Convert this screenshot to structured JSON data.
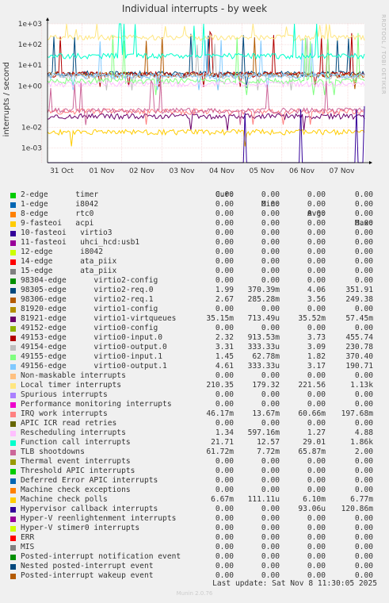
{
  "title": "Individual interrupts - by week",
  "side_label": "RRDTOOL / TOBI OETIKER",
  "footer": "Munin 2.0.76",
  "last_update": "Last update: Sat Nov  8 11:30:05 2025",
  "legend_headers": [
    "Cur:",
    "Min:",
    "Avg:",
    "Max:"
  ],
  "chart_data": {
    "type": "line",
    "ylabel": "interrupts / second",
    "yscale": "log",
    "ylim": [
      0.0002,
      1000
    ],
    "y_ticks": [
      {
        "v": 1000,
        "label": "1e+03"
      },
      {
        "v": 100,
        "label": "1e+02"
      },
      {
        "v": 10,
        "label": "1e+01"
      },
      {
        "v": 1,
        "label": "1e+00"
      },
      {
        "v": 0.01,
        "label": "1e-02"
      },
      {
        "v": 0.001,
        "label": "1e-03"
      }
    ],
    "x_ticks": [
      "31 Oct",
      "01 Nov",
      "02 Nov",
      "03 Nov",
      "04 Nov",
      "05 Nov",
      "06 Nov",
      "07 Nov"
    ],
    "series": [
      {
        "name": "2-edge      timer",
        "color": "#00cc00",
        "cur": "0.00",
        "min": "0.00",
        "avg": "0.00",
        "max": "0.00"
      },
      {
        "name": "1-edge      i8042",
        "color": "#0066b3",
        "cur": "0.00",
        "min": "0.00",
        "avg": "0.00",
        "max": "0.00"
      },
      {
        "name": "8-edge      rtc0",
        "color": "#ff8000",
        "cur": "0.00",
        "min": "0.00",
        "avg": "0.00",
        "max": "0.00"
      },
      {
        "name": "9-fasteoi   acpi",
        "color": "#ffcc00",
        "cur": "0.00",
        "min": "0.00",
        "avg": "0.00",
        "max": "0.00"
      },
      {
        "name": "10-fasteoi   virtio3",
        "color": "#330099",
        "cur": "0.00",
        "min": "0.00",
        "avg": "0.00",
        "max": "0.00"
      },
      {
        "name": "11-fasteoi   uhci_hcd:usb1",
        "color": "#990099",
        "cur": "0.00",
        "min": "0.00",
        "avg": "0.00",
        "max": "0.00"
      },
      {
        "name": "12-edge      i8042",
        "color": "#ccff00",
        "cur": "0.00",
        "min": "0.00",
        "avg": "0.00",
        "max": "0.00"
      },
      {
        "name": "14-edge      ata_piix",
        "color": "#ff0000",
        "cur": "0.00",
        "min": "0.00",
        "avg": "0.00",
        "max": "0.00"
      },
      {
        "name": "15-edge      ata_piix",
        "color": "#808080",
        "cur": "0.00",
        "min": "0.00",
        "avg": "0.00",
        "max": "0.00"
      },
      {
        "name": "98304-edge      virtio2-config",
        "color": "#008f00",
        "cur": "0.00",
        "min": "0.00",
        "avg": "0.00",
        "max": "0.00"
      },
      {
        "name": "98305-edge      virtio2-req.0",
        "color": "#00487d",
        "cur": "1.99",
        "min": "370.39m",
        "avg": "4.06",
        "max": "351.91"
      },
      {
        "name": "98306-edge      virtio2-req.1",
        "color": "#b35a00",
        "cur": "2.67",
        "min": "285.28m",
        "avg": "3.56",
        "max": "249.38"
      },
      {
        "name": "81920-edge      virtio1-config",
        "color": "#b38f00",
        "cur": "0.00",
        "min": "0.00",
        "avg": "0.00",
        "max": "0.00"
      },
      {
        "name": "81921-edge      virtio1-virtqueues",
        "color": "#6b006b",
        "cur": "35.15m",
        "min": "713.49u",
        "avg": "35.52m",
        "max": "57.45m"
      },
      {
        "name": "49152-edge      virtio0-config",
        "color": "#8fb300",
        "cur": "0.00",
        "min": "0.00",
        "avg": "0.00",
        "max": "0.00"
      },
      {
        "name": "49153-edge      virtio0-input.0",
        "color": "#b30000",
        "cur": "2.32",
        "min": "913.53m",
        "avg": "3.73",
        "max": "455.74"
      },
      {
        "name": "49154-edge      virtio0-output.0",
        "color": "#bebebe",
        "cur": "3.31",
        "min": "333.33u",
        "avg": "3.09",
        "max": "230.78"
      },
      {
        "name": "49155-edge      virtio0-input.1",
        "color": "#80ff80",
        "cur": "1.45",
        "min": "62.78m",
        "avg": "1.82",
        "max": "370.40"
      },
      {
        "name": "49156-edge      virtio0-output.1",
        "color": "#80c9ff",
        "cur": "4.61",
        "min": "333.33u",
        "avg": "3.17",
        "max": "190.71"
      },
      {
        "name": "Non-maskable interrupts",
        "color": "#ffc080",
        "cur": "0.00",
        "min": "0.00",
        "avg": "0.00",
        "max": "0.00"
      },
      {
        "name": "Local timer interrupts",
        "color": "#ffe680",
        "cur": "210.35",
        "min": "179.32",
        "avg": "221.56",
        "max": "1.13k"
      },
      {
        "name": "Spurious interrupts",
        "color": "#aa80ff",
        "cur": "0.00",
        "min": "0.00",
        "avg": "0.00",
        "max": "0.00"
      },
      {
        "name": "Performance monitoring interrupts",
        "color": "#ee00cc",
        "cur": "0.00",
        "min": "0.00",
        "avg": "0.00",
        "max": "0.00"
      },
      {
        "name": "IRQ work interrupts",
        "color": "#ff8080",
        "cur": "46.17m",
        "min": "13.67m",
        "avg": "60.66m",
        "max": "197.68m"
      },
      {
        "name": "APIC ICR read retries",
        "color": "#666600",
        "cur": "0.00",
        "min": "0.00",
        "avg": "0.00",
        "max": "0.00"
      },
      {
        "name": "Rescheduling interrupts",
        "color": "#ffbfff",
        "cur": "1.34",
        "min": "597.16m",
        "avg": "1.27",
        "max": "4.88"
      },
      {
        "name": "Function call interrupts",
        "color": "#00ffcc",
        "cur": "21.71",
        "min": "12.57",
        "avg": "29.01",
        "max": "1.86k"
      },
      {
        "name": "TLB shootdowns",
        "color": "#cc6699",
        "cur": "61.72m",
        "min": "7.72m",
        "avg": "65.87m",
        "max": "2.00"
      },
      {
        "name": "Thermal event interrupts",
        "color": "#999900",
        "cur": "0.00",
        "min": "0.00",
        "avg": "0.00",
        "max": "0.00"
      },
      {
        "name": "Threshold APIC interrupts",
        "color": "#00cc00",
        "cur": "0.00",
        "min": "0.00",
        "avg": "0.00",
        "max": "0.00"
      },
      {
        "name": "Deferred Error APIC interrupts",
        "color": "#0066b3",
        "cur": "0.00",
        "min": "0.00",
        "avg": "0.00",
        "max": "0.00"
      },
      {
        "name": "Machine check exceptions",
        "color": "#ff8000",
        "cur": "0.00",
        "min": "0.00",
        "avg": "0.00",
        "max": "0.00"
      },
      {
        "name": "Machine check polls",
        "color": "#ffcc00",
        "cur": "6.67m",
        "min": "111.11u",
        "avg": "6.10m",
        "max": "6.77m"
      },
      {
        "name": "Hypervisor callback interrupts",
        "color": "#330099",
        "cur": "0.00",
        "min": "0.00",
        "avg": "93.06u",
        "max": "120.86m"
      },
      {
        "name": "Hyper-V reenlightenment interrupts",
        "color": "#990099",
        "cur": "0.00",
        "min": "0.00",
        "avg": "0.00",
        "max": "0.00"
      },
      {
        "name": "Hyper-V stimer0 interrupts",
        "color": "#ccff00",
        "cur": "0.00",
        "min": "0.00",
        "avg": "0.00",
        "max": "0.00"
      },
      {
        "name": "ERR",
        "color": "#ff0000",
        "cur": "0.00",
        "min": "0.00",
        "avg": "0.00",
        "max": "0.00"
      },
      {
        "name": "MIS",
        "color": "#808080",
        "cur": "0.00",
        "min": "0.00",
        "avg": "0.00",
        "max": "0.00"
      },
      {
        "name": "Posted-interrupt notification event",
        "color": "#008f00",
        "cur": "0.00",
        "min": "0.00",
        "avg": "0.00",
        "max": "0.00"
      },
      {
        "name": "Nested posted-interrupt event",
        "color": "#00487d",
        "cur": "0.00",
        "min": "0.00",
        "avg": "0.00",
        "max": "0.00"
      },
      {
        "name": "Posted-interrupt wakeup event",
        "color": "#b35a00",
        "cur": "0.00",
        "min": "0.00",
        "avg": "0.00",
        "max": "0.00"
      }
    ]
  }
}
